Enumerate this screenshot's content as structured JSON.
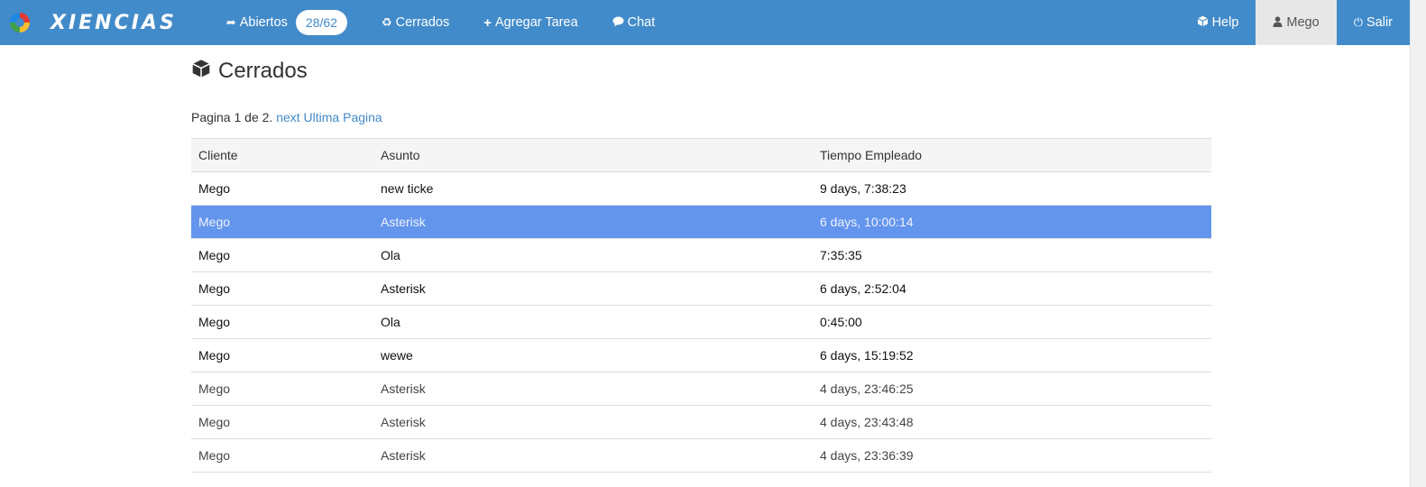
{
  "brand": {
    "name": "XIENCIAS"
  },
  "nav": {
    "abiertos": {
      "icon": "share-icon",
      "label": "Abiertos",
      "badge": "28/62"
    },
    "cerrados": {
      "icon": "recycle-icon",
      "label": "Cerrados"
    },
    "agregar": {
      "icon": "plus-icon",
      "label": "Agregar Tarea"
    },
    "chat": {
      "icon": "comment-icon",
      "label": "Chat"
    },
    "help": {
      "icon": "cube-icon",
      "label": "Help"
    },
    "user": {
      "icon": "user-icon",
      "label": "Mego"
    },
    "salir": {
      "icon": "power-icon",
      "label": "Salir"
    }
  },
  "page": {
    "title": "Cerrados",
    "title_icon": "cube-icon",
    "pager_text": "Pagina 1 de 2.",
    "next_link": "next",
    "last_link": "Ultima Pagina"
  },
  "table": {
    "headers": [
      "Cliente",
      "Asunto",
      "Tiempo Empleado"
    ],
    "rows": [
      {
        "cliente": "Mego",
        "asunto": "new ticke",
        "tiempo": "9 days, 7:38:23"
      },
      {
        "cliente": "Mego",
        "asunto": "Asterisk",
        "tiempo": "6 days, 10:00:14",
        "selected": true
      },
      {
        "cliente": "Mego",
        "asunto": "Ola",
        "tiempo": "7:35:35"
      },
      {
        "cliente": "Mego",
        "asunto": "Asterisk",
        "tiempo": "6 days, 2:52:04"
      },
      {
        "cliente": "Mego",
        "asunto": "Ola",
        "tiempo": "0:45:00"
      },
      {
        "cliente": "Mego",
        "asunto": "wewe",
        "tiempo": "6 days, 15:19:52"
      },
      {
        "cliente": "Mego",
        "asunto": "Asterisk",
        "tiempo": "4 days, 23:46:25"
      },
      {
        "cliente": "Mego",
        "asunto": "Asterisk",
        "tiempo": "4 days, 23:43:48"
      },
      {
        "cliente": "Mego",
        "asunto": "Asterisk",
        "tiempo": "4 days, 23:36:39"
      }
    ]
  },
  "colors": {
    "navbar": "#428bca",
    "selected_row": "#6495ed",
    "link": "#428bca"
  }
}
